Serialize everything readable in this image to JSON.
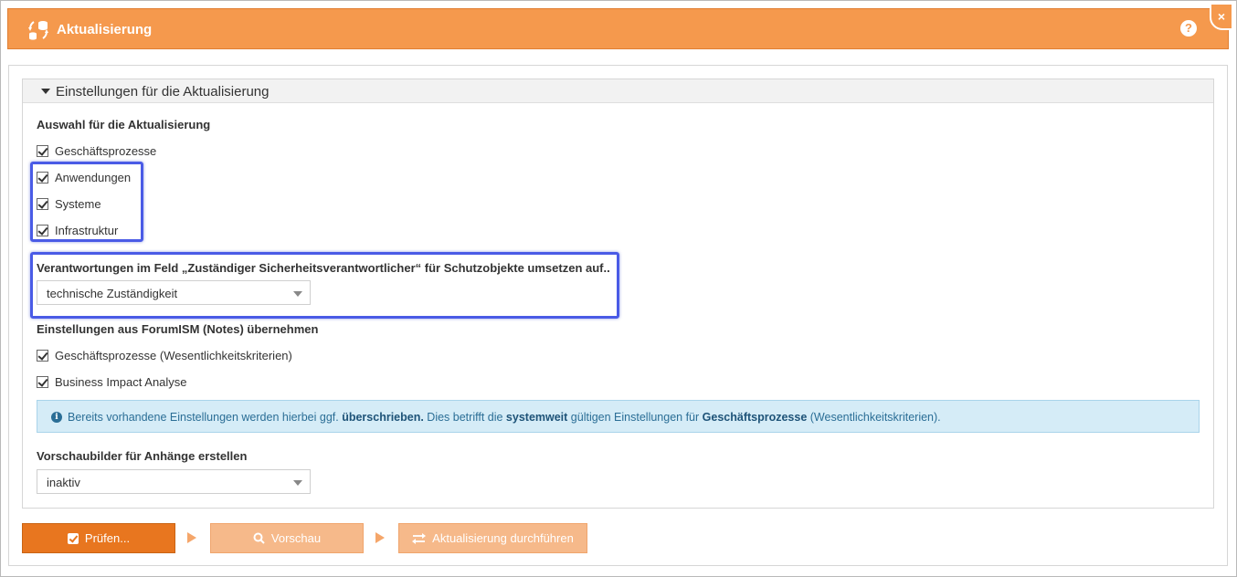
{
  "window": {
    "title": "Aktualisierung",
    "help_label": "?",
    "close_label": "×"
  },
  "panel": {
    "title": "Einstellungen für die Aktualisierung"
  },
  "selection": {
    "label": "Auswahl für die Aktualisierung",
    "items": [
      {
        "label": "Geschäftsprozesse",
        "checked": true
      },
      {
        "label": "Anwendungen",
        "checked": true
      },
      {
        "label": "Systeme",
        "checked": true
      },
      {
        "label": "Infrastruktur",
        "checked": true
      }
    ]
  },
  "responsibility": {
    "label": "Verantwortungen im Feld „Zuständiger Sicherheitsverantwortlicher“ für Schutzobjekte umsetzen auf..",
    "value": "technische Zuständigkeit"
  },
  "forumism": {
    "label": "Einstellungen aus ForumISM (Notes) übernehmen",
    "items": [
      {
        "label": "Geschäftsprozesse (Wesentlichkeitskriterien)",
        "checked": true
      },
      {
        "label": "Business Impact Analyse",
        "checked": true
      }
    ]
  },
  "info": {
    "part1": "Bereits vorhandene Einstellungen werden hierbei ggf. ",
    "bold1": "überschrieben.",
    "part2": " Dies betrifft die ",
    "bold2": "systemweit",
    "part3": " gültigen Einstellungen für ",
    "bold3": "Geschäftsprozesse",
    "part4": " (Wesentlichkeitskriterien)."
  },
  "preview": {
    "label": "Vorschaubilder für Anhänge erstellen",
    "value": "inaktiv"
  },
  "buttons": {
    "check": "Prüfen...",
    "preview": "Vorschau",
    "run": "Aktualisierung durchführen"
  },
  "colors": {
    "accent": "#f5994d",
    "primary_button": "#e8761f",
    "disabled_button": "#f6b98a",
    "highlight": "#4a5be6",
    "info_bg": "#d5ecf7"
  }
}
